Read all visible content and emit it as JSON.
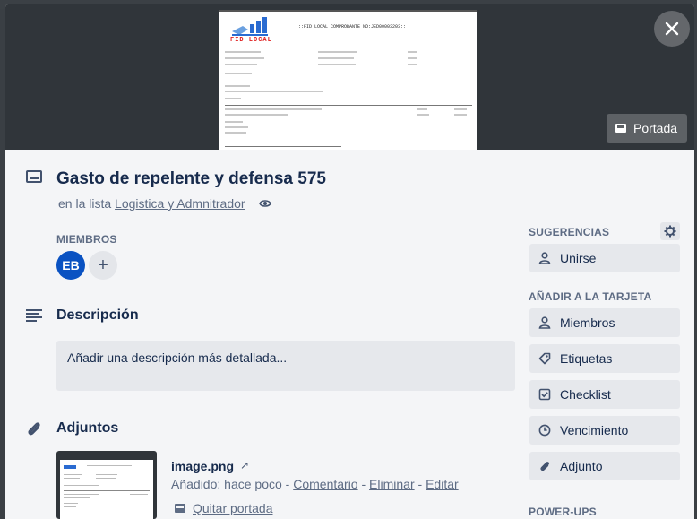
{
  "cover": {
    "document": {
      "logo_text": "FID LOCAL",
      "header_text": "::FID LOCAL COMPROBANTE NO:JED00003203::"
    },
    "cover_button_label": "Portada",
    "close_icon": "close-icon"
  },
  "card": {
    "title": "Gasto de repelente y defensa 575",
    "in_list_prefix": "en la lista",
    "list_name": "Logistica y Admnitrador"
  },
  "members": {
    "label": "MIEMBROS",
    "avatar_initials": "EB",
    "add_symbol": "+"
  },
  "description": {
    "title": "Descripción",
    "placeholder": "Añadir una descripción más detallada..."
  },
  "attachments": {
    "title": "Adjuntos",
    "items": [
      {
        "name": "image.png",
        "external_symbol": "↗",
        "added_text": "Añadido: hace poco",
        "sep": " - ",
        "comment": "Comentario",
        "delete": "Eliminar",
        "edit": "Editar",
        "remove_cover": "Quitar portada"
      }
    ]
  },
  "sidebar": {
    "suggestions_label": "SUGERENCIAS",
    "suggestions": [
      {
        "label": "Unirse",
        "icon": "person-icon"
      }
    ],
    "add_to_card_label": "AÑADIR A LA TARJETA",
    "add_to_card": [
      {
        "label": "Miembros",
        "icon": "person-icon"
      },
      {
        "label": "Etiquetas",
        "icon": "tag-icon"
      },
      {
        "label": "Checklist",
        "icon": "checkbox-icon"
      },
      {
        "label": "Vencimiento",
        "icon": "clock-icon"
      },
      {
        "label": "Adjunto",
        "icon": "paperclip-icon"
      }
    ],
    "power_ups_label": "POWER-UPS"
  }
}
